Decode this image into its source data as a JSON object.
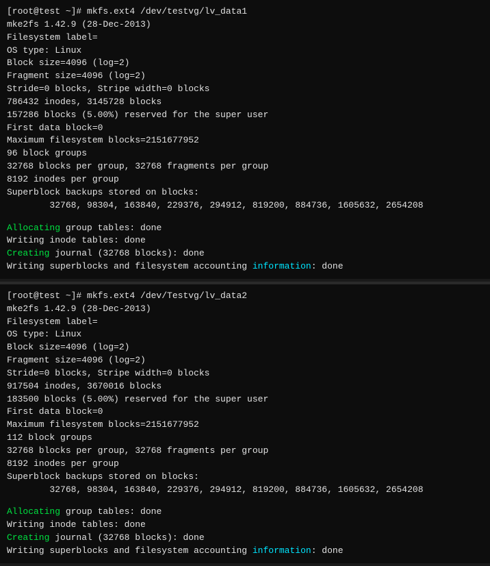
{
  "terminal1": {
    "lines": [
      {
        "text": "[root@test ~]# mkfs.ext4 /dev/testvg/lv_data1",
        "type": "normal"
      },
      {
        "text": "mke2fs 1.42.9 (28-Dec-2013)",
        "type": "normal"
      },
      {
        "text": "Filesystem label=",
        "type": "normal"
      },
      {
        "text": "OS type: Linux",
        "type": "normal"
      },
      {
        "text": "Block size=4096 (log=2)",
        "type": "normal"
      },
      {
        "text": "Fragment size=4096 (log=2)",
        "type": "normal"
      },
      {
        "text": "Stride=0 blocks, Stripe width=0 blocks",
        "type": "normal"
      },
      {
        "text": "786432 inodes, 3145728 blocks",
        "type": "normal"
      },
      {
        "text": "157286 blocks (5.00%) reserved for the super user",
        "type": "normal"
      },
      {
        "text": "First data block=0",
        "type": "normal"
      },
      {
        "text": "Maximum filesystem blocks=2151677952",
        "type": "normal"
      },
      {
        "text": "96 block groups",
        "type": "normal"
      },
      {
        "text": "32768 blocks per group, 32768 fragments per group",
        "type": "normal"
      },
      {
        "text": "8192 inodes per group",
        "type": "normal"
      },
      {
        "text": "Superblock backups stored on blocks:",
        "type": "normal"
      },
      {
        "text": "        32768, 98304, 163840, 229376, 294912, 819200, 884736, 1605632, 2654208",
        "type": "normal"
      },
      {
        "text": "",
        "type": "empty"
      },
      {
        "text": "Allocating group tables: done",
        "type": "alloc"
      },
      {
        "text": "Writing inode tables: done",
        "type": "normal"
      },
      {
        "text": "Creating journal (32768 blocks): done",
        "type": "creating"
      },
      {
        "text": "Writing superblocks and filesystem accounting ",
        "type": "writing",
        "suffix": "information",
        "suffixColor": "cyan",
        "end": ": done"
      }
    ]
  },
  "terminal2": {
    "lines": [
      {
        "text": "[root@test ~]# mkfs.ext4 /dev/Testvg/lv_data2",
        "type": "normal"
      },
      {
        "text": "mke2fs 1.42.9 (28-Dec-2013)",
        "type": "normal"
      },
      {
        "text": "Filesystem label=",
        "type": "normal"
      },
      {
        "text": "OS type: Linux",
        "type": "normal"
      },
      {
        "text": "Block size=4096 (log=2)",
        "type": "normal"
      },
      {
        "text": "Fragment size=4096 (log=2)",
        "type": "normal"
      },
      {
        "text": "Stride=0 blocks, Stripe width=0 blocks",
        "type": "normal"
      },
      {
        "text": "917504 inodes, 3670016 blocks",
        "type": "normal"
      },
      {
        "text": "183500 blocks (5.00%) reserved for the super user",
        "type": "normal"
      },
      {
        "text": "First data block=0",
        "type": "normal"
      },
      {
        "text": "Maximum filesystem blocks=2151677952",
        "type": "normal"
      },
      {
        "text": "112 block groups",
        "type": "normal"
      },
      {
        "text": "32768 blocks per group, 32768 fragments per group",
        "type": "normal"
      },
      {
        "text": "8192 inodes per group",
        "type": "normal"
      },
      {
        "text": "Superblock backups stored on blocks:",
        "type": "normal"
      },
      {
        "text": "        32768, 98304, 163840, 229376, 294912, 819200, 884736, 1605632, 2654208",
        "type": "normal"
      },
      {
        "text": "",
        "type": "empty"
      },
      {
        "text": "Allocating group tables: done",
        "type": "alloc"
      },
      {
        "text": "Writing inode tables: done",
        "type": "normal"
      },
      {
        "text": "Creating journal (32768 blocks): done",
        "type": "creating"
      },
      {
        "text": "Writing superblocks and filesystem accounting ",
        "type": "writing",
        "suffix": "information",
        "suffixColor": "cyan",
        "end": ": done"
      }
    ]
  },
  "colors": {
    "cyan": "#00e5ff",
    "green": "#00cc55",
    "text": "#e0e0e0",
    "bg": "#0d0d0d"
  }
}
